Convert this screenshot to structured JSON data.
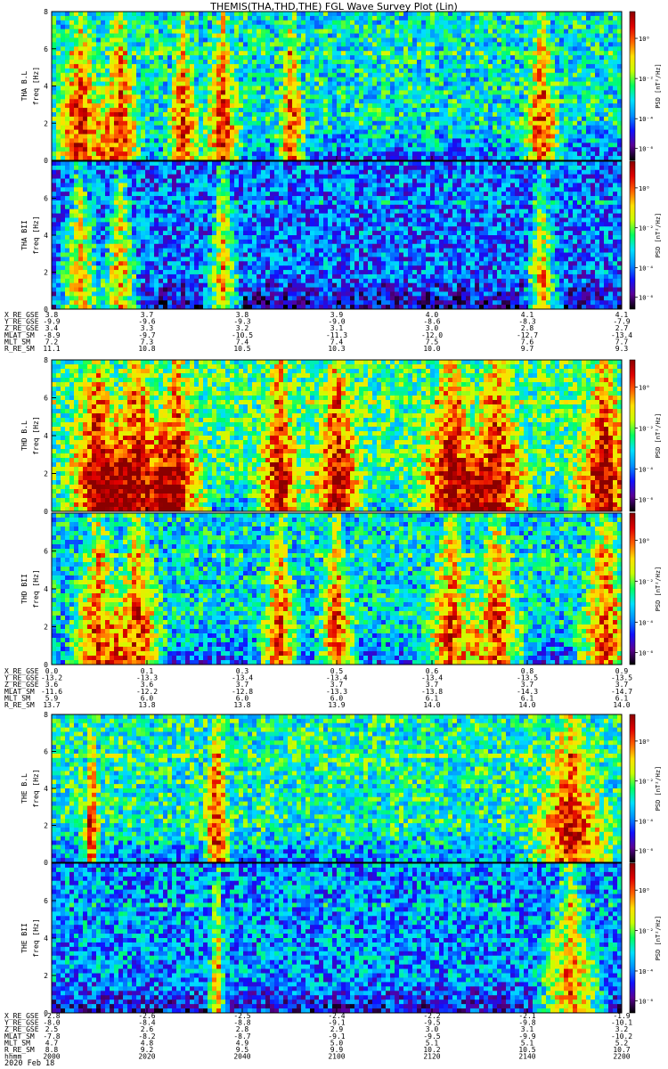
{
  "title": "THEMIS(THA,THD,THE) FGL Wave Survey Plot (Lin)",
  "footer_date": "2020 Feb 18",
  "colorbar": {
    "label": "PSD [nT²/Hz]",
    "ticks": [
      "10⁰",
      "10⁻²",
      "10⁻⁴",
      "10⁻⁶"
    ],
    "colors": [
      "#000000",
      "#5a0094",
      "#1010ff",
      "#0090ff",
      "#00e0ff",
      "#00ff60",
      "#c8ff00",
      "#ffe000",
      "#ff6000",
      "#e00000",
      "#8a0000"
    ]
  },
  "chart_data": {
    "type": "heatmap",
    "x_ticks_hhmm": [
      "2000",
      "2020",
      "2040",
      "2100",
      "2120",
      "2140",
      "2200"
    ],
    "y_ticks": [
      "0",
      "2",
      "4",
      "6",
      "8"
    ],
    "y_label": "freq [Hz]",
    "ylim": [
      0,
      8
    ],
    "panels": [
      {
        "id": "tha_bl",
        "label": "THA B.L",
        "seed": 11,
        "base": 0.42,
        "bursts": [
          {
            "x": 0.05,
            "s": 0.1
          },
          {
            "x": 0.12,
            "s": 0.08
          },
          {
            "x": 0.23,
            "s": 0.06
          },
          {
            "x": 0.3,
            "s": 0.07
          },
          {
            "x": 0.42,
            "s": 0.05
          },
          {
            "x": 0.86,
            "s": 0.07
          }
        ]
      },
      {
        "id": "tha_bii",
        "label": "THA BII",
        "seed": 23,
        "base": 0.28,
        "bursts": [
          {
            "x": 0.05,
            "s": 0.08
          },
          {
            "x": 0.12,
            "s": 0.07
          },
          {
            "x": 0.3,
            "s": 0.06
          },
          {
            "x": 0.86,
            "s": 0.06
          }
        ]
      },
      {
        "id": "thd_bl",
        "label": "THD B.L",
        "seed": 37,
        "base": 0.5,
        "bursts": [
          {
            "x": 0.08,
            "s": 0.12
          },
          {
            "x": 0.15,
            "s": 0.13
          },
          {
            "x": 0.22,
            "s": 0.1
          },
          {
            "x": 0.4,
            "s": 0.08
          },
          {
            "x": 0.5,
            "s": 0.1
          },
          {
            "x": 0.7,
            "s": 0.13
          },
          {
            "x": 0.78,
            "s": 0.12
          },
          {
            "x": 0.97,
            "s": 0.12
          }
        ]
      },
      {
        "id": "thd_bii",
        "label": "THD BII",
        "seed": 41,
        "base": 0.4,
        "bursts": [
          {
            "x": 0.08,
            "s": 0.1
          },
          {
            "x": 0.15,
            "s": 0.1
          },
          {
            "x": 0.4,
            "s": 0.07
          },
          {
            "x": 0.5,
            "s": 0.07
          },
          {
            "x": 0.7,
            "s": 0.1
          },
          {
            "x": 0.78,
            "s": 0.1
          },
          {
            "x": 0.97,
            "s": 0.1
          }
        ]
      },
      {
        "id": "the_bl",
        "label": "THE B.L",
        "seed": 53,
        "base": 0.45,
        "bursts": [
          {
            "x": 0.07,
            "s": 0.03
          },
          {
            "x": 0.29,
            "s": 0.05
          },
          {
            "x": 0.91,
            "s": 0.15
          }
        ]
      },
      {
        "id": "the_bii",
        "label": "THE BII",
        "seed": 67,
        "base": 0.32,
        "bursts": [
          {
            "x": 0.29,
            "s": 0.03
          },
          {
            "x": 0.91,
            "s": 0.12
          }
        ]
      }
    ],
    "ephemeris": [
      {
        "rows": [
          {
            "name": "X_RE_GSE",
            "values": [
              "3.8",
              "3.7",
              "3.8",
              "3.9",
              "4.0",
              "4.1",
              "4.1"
            ]
          },
          {
            "name": "Y_RE_GSE",
            "values": [
              "-9.9",
              "-9.6",
              "-9.3",
              "-9.0",
              "-8.6",
              "-8.3",
              "-7.9"
            ]
          },
          {
            "name": "Z_RE_GSE",
            "values": [
              "3.4",
              "3.3",
              "3.2",
              "3.1",
              "3.0",
              "2.8",
              "2.7"
            ]
          },
          {
            "name": "MLAT_SM",
            "values": [
              "-8.9",
              "-9.7",
              "-10.5",
              "-11.3",
              "-12.0",
              "-12.7",
              "-13.4"
            ]
          },
          {
            "name": "MLT_SM",
            "values": [
              "7.2",
              "7.3",
              "7.4",
              "7.4",
              "7.5",
              "7.6",
              "7.7"
            ]
          },
          {
            "name": "R_RE_SM",
            "values": [
              "11.1",
              "10.8",
              "10.5",
              "10.3",
              "10.0",
              "9.7",
              "9.3"
            ]
          }
        ]
      },
      {
        "rows": [
          {
            "name": "X_RE_GSE",
            "values": [
              "0.0",
              "0.1",
              "0.3",
              "0.5",
              "0.6",
              "0.8",
              "0.9"
            ]
          },
          {
            "name": "Y_RE_GSE",
            "values": [
              "-13.2",
              "-13.3",
              "-13.4",
              "-13.4",
              "-13.4",
              "-13.5",
              "-13.5"
            ]
          },
          {
            "name": "Z_RE_GSE",
            "values": [
              "3.6",
              "3.6",
              "3.7",
              "3.7",
              "3.7",
              "3.7",
              "3.7"
            ]
          },
          {
            "name": "MLAT_SM",
            "values": [
              "-11.6",
              "-12.2",
              "-12.8",
              "-13.3",
              "-13.8",
              "-14.3",
              "-14.7"
            ]
          },
          {
            "name": "MLT_SM",
            "values": [
              "5.9",
              "6.0",
              "6.0",
              "6.0",
              "6.1",
              "6.1",
              "6.1"
            ]
          },
          {
            "name": "R_RE_SM",
            "values": [
              "13.7",
              "13.8",
              "13.8",
              "13.9",
              "14.0",
              "14.0",
              "14.0"
            ]
          }
        ]
      },
      {
        "rows": [
          {
            "name": "X_RE_GSE",
            "values": [
              "-2.8",
              "-2.6",
              "-2.5",
              "-2.4",
              "-2.2",
              "-2.1",
              "-1.9"
            ]
          },
          {
            "name": "Y_RE_GSE",
            "values": [
              "-8.0",
              "-8.4",
              "-8.8",
              "-9.1",
              "-9.5",
              "-9.8",
              "-10.1"
            ]
          },
          {
            "name": "Z_RE_GSE",
            "values": [
              "2.5",
              "2.6",
              "2.8",
              "2.9",
              "3.0",
              "3.1",
              "3.2"
            ]
          },
          {
            "name": "MLAT_SM",
            "values": [
              "-7.8",
              "-8.2",
              "-8.7",
              "-9.1",
              "-9.5",
              "-9.9",
              "-10.2"
            ]
          },
          {
            "name": "MLT_SM",
            "values": [
              "4.7",
              "4.8",
              "4.9",
              "5.0",
              "5.1",
              "5.1",
              "5.2"
            ]
          },
          {
            "name": "R_RE_SM",
            "values": [
              "8.8",
              "9.2",
              "9.5",
              "9.9",
              "10.2",
              "10.5",
              "10.7"
            ]
          },
          {
            "name": "hhmm",
            "values": [
              "2000",
              "2020",
              "2040",
              "2100",
              "2120",
              "2140",
              "2200"
            ]
          }
        ]
      }
    ]
  }
}
